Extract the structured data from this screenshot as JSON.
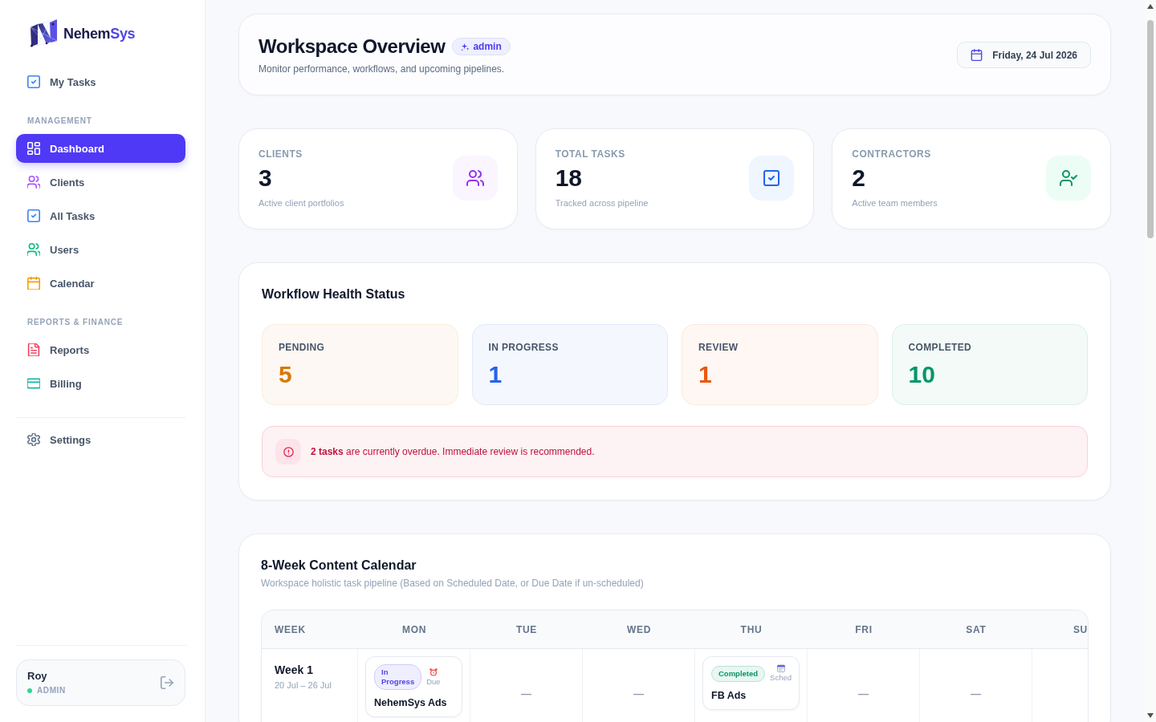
{
  "sidebar": {
    "logo": {
      "name_parts": [
        "Nehem",
        "Sys"
      ]
    },
    "top_items": [
      {
        "label": "My Tasks",
        "kind": "tasks",
        "selected": false
      }
    ],
    "sections": [
      {
        "title": "MANAGEMENT",
        "items": [
          {
            "label": "Dashboard",
            "kind": "dashboard",
            "selected": true
          },
          {
            "label": "Clients",
            "kind": "clients",
            "selected": false
          },
          {
            "label": "All Tasks",
            "kind": "tasks",
            "selected": false
          },
          {
            "label": "Users",
            "kind": "users",
            "selected": false
          },
          {
            "label": "Calendar",
            "kind": "calendar",
            "selected": false
          }
        ]
      },
      {
        "title": "REPORTS & FINANCE",
        "items": [
          {
            "label": "Reports",
            "kind": "reports",
            "selected": false
          },
          {
            "label": "Billing",
            "kind": "billing",
            "selected": false
          }
        ]
      }
    ],
    "bottom_items": [
      {
        "label": "Settings",
        "kind": "settings",
        "selected": false
      }
    ],
    "user": {
      "name": "Roy",
      "role": "ADMIN"
    }
  },
  "header": {
    "title": "Workspace Overview",
    "role_tag": "admin",
    "subtitle": "Monitor performance, workflows, and upcoming pipelines.",
    "date": "Friday, 24 Jul 2026"
  },
  "stats": [
    {
      "label": "CLIENTS",
      "value": "3",
      "caption": "Active client portfolios",
      "kind": "clients"
    },
    {
      "label": "TOTAL TASKS",
      "value": "18",
      "caption": "Tracked across pipeline",
      "kind": "tasks"
    },
    {
      "label": "CONTRACTORS",
      "value": "2",
      "caption": "Active team members",
      "kind": "contractors"
    }
  ],
  "workflow": {
    "title": "Workflow Health Status",
    "statuses": [
      {
        "label": "PENDING",
        "value": "5",
        "color": "#d97706"
      },
      {
        "label": "IN PROGRESS",
        "value": "1",
        "color": "#2563eb"
      },
      {
        "label": "REVIEW",
        "value": "1",
        "color": "#ea580c"
      },
      {
        "label": "COMPLETED",
        "value": "10",
        "color": "#059669"
      }
    ],
    "alert": "**2 tasks** are currently overdue. Immediate review is recommended."
  },
  "calendar": {
    "title": "8-Week Content Calendar",
    "subtitle": "Workspace holistic task pipeline (Based on Scheduled Date, or Due Date if un-scheduled)",
    "columns": [
      "WEEK",
      "MON",
      "TUE",
      "WED",
      "THU",
      "FRI",
      "SAT",
      "SU"
    ],
    "weeks": [
      {
        "label": "Week 1",
        "range": "20 Jul – 26 Jul",
        "days": [
          {
            "tasks": [
              {
                "status": "In Progress",
                "color": "#4f46e5",
                "kind": "due",
                "date_label": "Due",
                "title": "NehemSys Ads"
              }
            ]
          },
          {
            "empty_mark": "—"
          },
          {
            "empty_mark": "—"
          },
          {
            "tasks": [
              {
                "status": "Completed",
                "color": "#059669",
                "kind": "scheduled",
                "date_label": "Sched",
                "title": "FB Ads"
              }
            ]
          },
          {
            "empty_mark": "—"
          },
          {
            "empty_mark": "—"
          }
        ]
      }
    ]
  }
}
